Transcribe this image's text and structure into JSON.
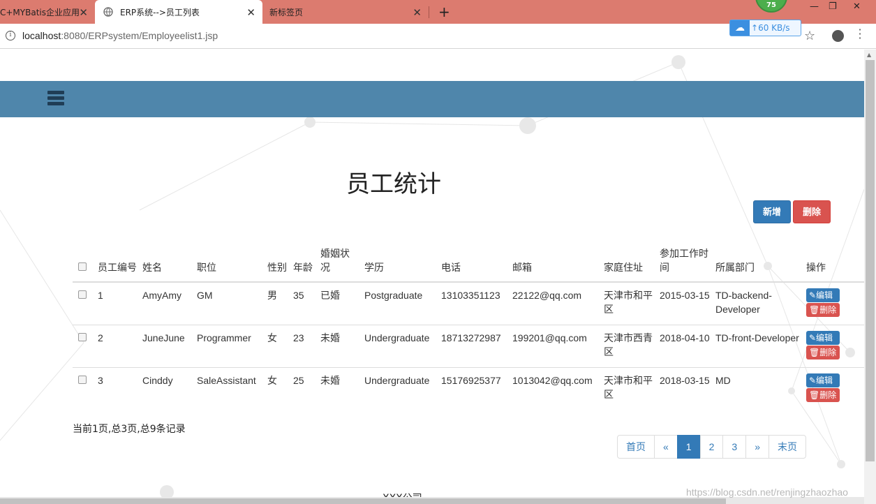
{
  "browser": {
    "tabs": [
      {
        "title": "C+MYBatis企业应用"
      },
      {
        "title": "ERP系统-->员工列表"
      },
      {
        "title": "新标签页"
      }
    ],
    "close_glyph": "✕",
    "new_tab_glyph": "+",
    "url_host": "localhost",
    "url_path": ":8080/ERPsystem/Employeelist1.jsp",
    "badge_value": "75",
    "upload_speed": "60 KB/s",
    "window_controls": [
      "—",
      "❐",
      "✕"
    ]
  },
  "page": {
    "title": "员工统计",
    "add_button": "新增",
    "delete_button": "删除",
    "table": {
      "headers": [
        "员工编号",
        "姓名",
        "职位",
        "性别",
        "年龄",
        "婚姻状况",
        "学历",
        "电话",
        "邮箱",
        "家庭住址",
        "参加工作时间",
        "所属部门",
        "操作"
      ],
      "rows": [
        [
          "1",
          "AmyAmy",
          "GM",
          "男",
          "35",
          "已婚",
          "Postgraduate",
          "13103351123",
          "22122@qq.com",
          "天津市和平区",
          "2015-03-15",
          "TD-backend-Developer"
        ],
        [
          "2",
          "JuneJune",
          "Programmer",
          "女",
          "23",
          "未婚",
          "Undergraduate",
          "18713272987",
          "199201@qq.com",
          "天津市西青区",
          "2018-04-10",
          "TD-front-Developer"
        ],
        [
          "3",
          "Cinddy",
          "SaleAssistant",
          "女",
          "25",
          "未婚",
          "Undergraduate",
          "15176925377",
          "1013042@qq.com",
          "天津市和平区",
          "2018-03-15",
          "MD"
        ]
      ],
      "edit_label": "✎编辑",
      "delete_label": "🗑删除"
    },
    "summary": "当前1页,总3页,总9条记录",
    "pagination": [
      "首页",
      "«",
      "1",
      "2",
      "3",
      "»",
      "末页"
    ],
    "active_page": "1",
    "footer": "XXX公司",
    "watermark": "https://blog.csdn.net/renjingzhaozhao"
  },
  "colors": {
    "tabbar": "#dc7b6f",
    "navbar": "#4f86ab",
    "primary": "#337ab7",
    "danger": "#d9534f"
  }
}
